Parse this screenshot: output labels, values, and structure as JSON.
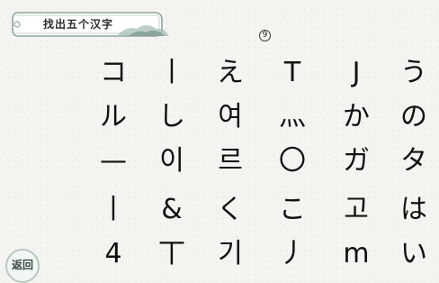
{
  "title": "找出五个汉字",
  "counter": "9",
  "back_label": "返回",
  "grid": [
    [
      "コ",
      "丨",
      "え",
      "T",
      "J",
      "う"
    ],
    [
      "ル",
      "し",
      "여",
      "灬",
      "か",
      "の"
    ],
    [
      "—",
      "이",
      "르",
      "〇",
      "ガ",
      "タ"
    ],
    [
      "丨",
      "&",
      "く",
      "こ",
      "고",
      "は"
    ],
    [
      "4",
      "丅",
      "기",
      "丿",
      "m",
      "い"
    ]
  ]
}
